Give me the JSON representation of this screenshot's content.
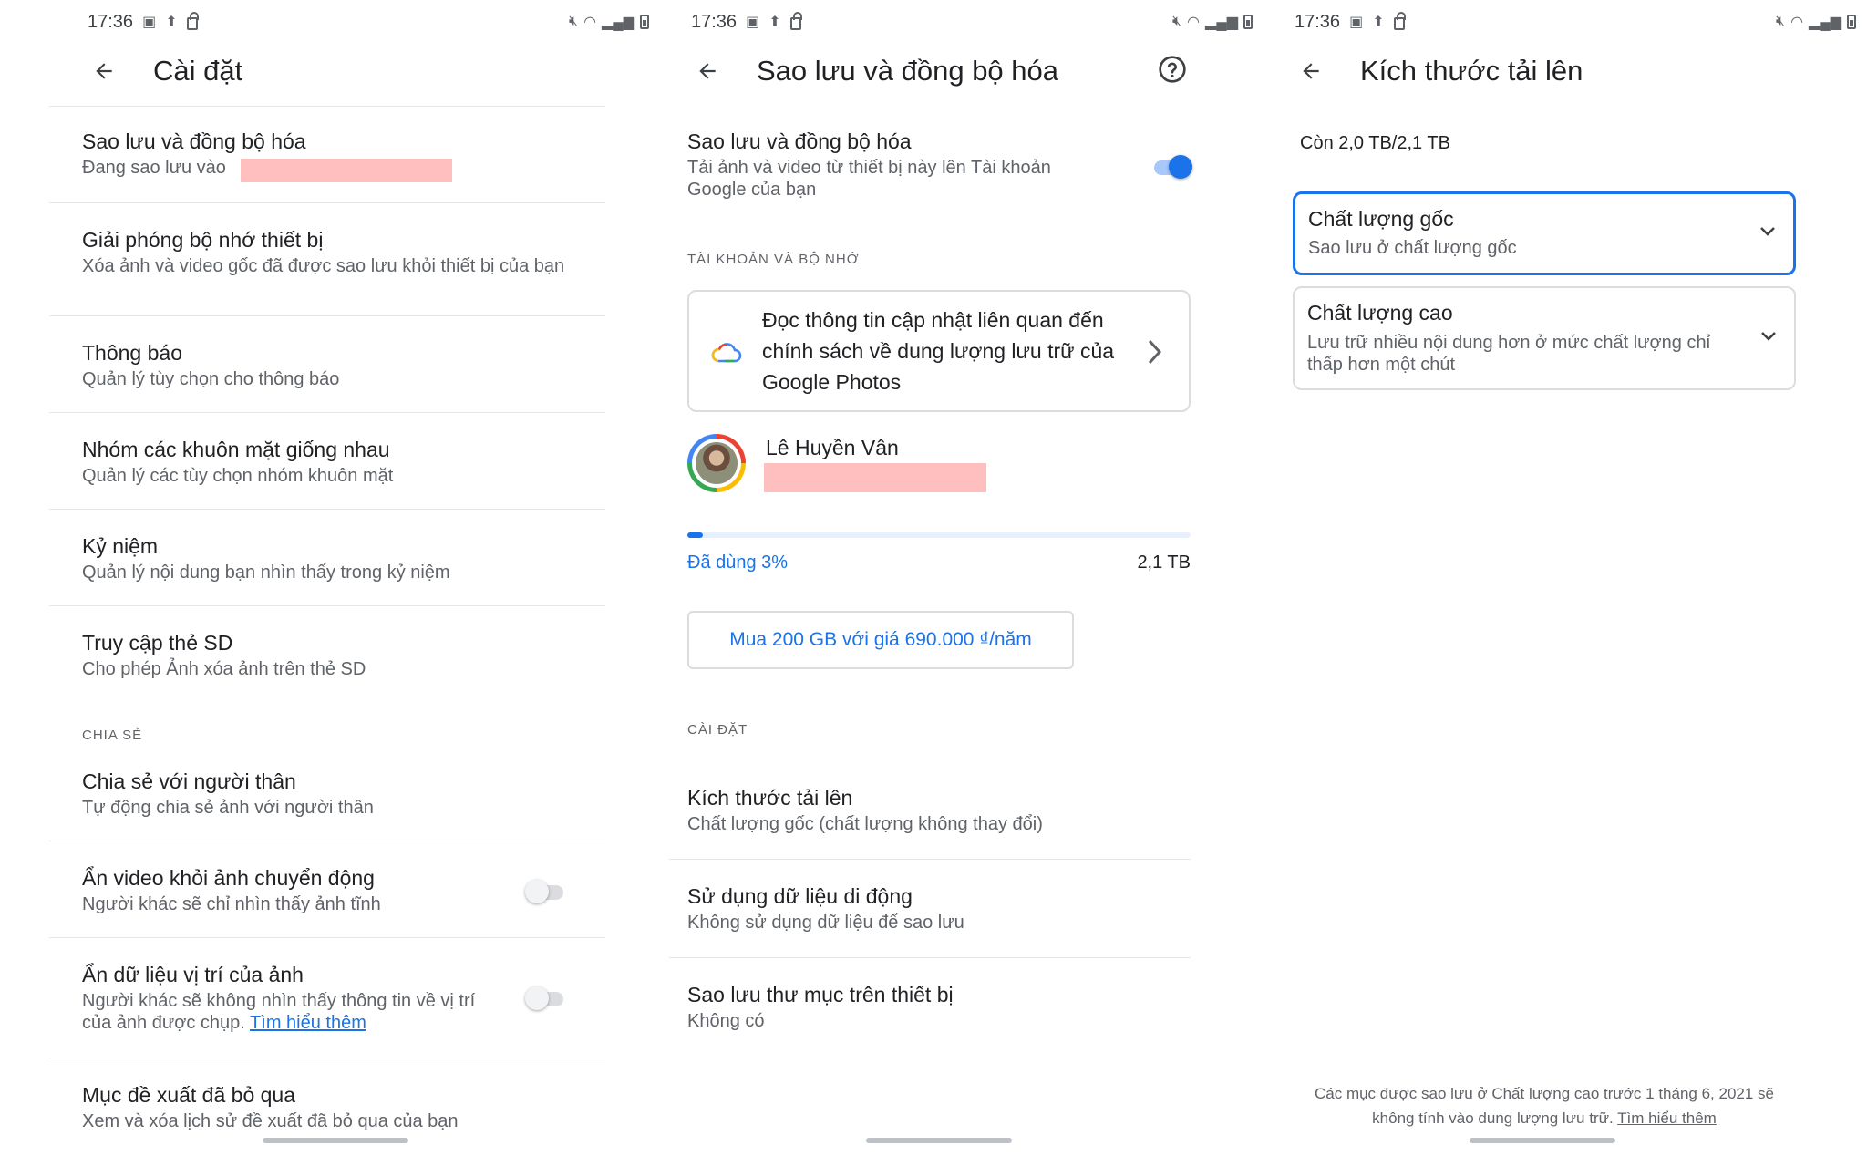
{
  "status": {
    "time": "17:36"
  },
  "panel1": {
    "title": "Cài đặt",
    "items": [
      {
        "title": "Sao lưu và đồng bộ hóa",
        "subtitle": "Đang sao lưu vào"
      },
      {
        "title": "Giải phóng bộ nhớ thiết bị",
        "subtitle": "Xóa ảnh và video gốc đã được sao lưu khỏi thiết bị của bạn"
      },
      {
        "title": "Thông báo",
        "subtitle": "Quản lý tùy chọn cho thông báo"
      },
      {
        "title": "Nhóm các khuôn mặt giống nhau",
        "subtitle": "Quản lý các tùy chọn nhóm khuôn mặt"
      },
      {
        "title": "Kỷ niệm",
        "subtitle": "Quản lý nội dung bạn nhìn thấy trong kỷ niệm"
      },
      {
        "title": "Truy cập thẻ SD",
        "subtitle": "Cho phép Ảnh xóa ảnh trên thẻ SD"
      }
    ],
    "section_sharing": "CHIA SẺ",
    "partner": {
      "title": "Chia sẻ với người thân",
      "subtitle": "Tự động chia sẻ ảnh với người thân"
    },
    "hide_video": {
      "title": "Ẩn video khỏi ảnh chuyển động",
      "subtitle": "Người khác sẽ chỉ nhìn thấy ảnh tĩnh",
      "enabled": false
    },
    "hide_location": {
      "title": "Ẩn dữ liệu vị trí của ảnh",
      "subtitle_line1": "Người khác sẽ không nhìn thấy thông tin về vị trí",
      "subtitle_line2": "của ảnh được chụp.",
      "link": "Tìm hiểu thêm",
      "enabled": false
    },
    "skipped": {
      "title": "Mục đề xuất đã bỏ qua",
      "subtitle": "Xem và xóa lịch sử đề xuất đã bỏ qua của bạn"
    }
  },
  "panel2": {
    "title": "Sao lưu và đồng bộ hóa",
    "backup": {
      "title": "Sao lưu và đồng bộ hóa",
      "subtitle": "Tải ảnh và video từ thiết bị này lên Tài khoản Google của bạn",
      "enabled": true
    },
    "section_account": "TÀI KHOẢN VÀ BỘ NHỚ",
    "policy_card": "Đọc thông tin cập nhật liên quan đến chính sách về dung lượng lưu trữ của Google Photos",
    "account_name": "Lê Huyền Vân",
    "storage": {
      "used_label": "Đã dùng 3%",
      "used_fraction": 0.03,
      "total": "2,1 TB"
    },
    "buy_button": "Mua 200 GB với giá 690.000 ₫/năm",
    "section_settings": "CÀI ĐẶT",
    "upload_size": {
      "title": "Kích thước tải lên",
      "subtitle": "Chất lượng gốc (chất lượng không thay đổi)"
    },
    "mobile_data": {
      "title": "Sử dụng dữ liệu di động",
      "subtitle": "Không sử dụng dữ liệu để sao lưu"
    },
    "device_folders": {
      "title": "Sao lưu thư mục trên thiết bị",
      "subtitle": "Không có"
    }
  },
  "panel3": {
    "title": "Kích thước tải lên",
    "remaining": "Còn 2,0 TB/2,1 TB",
    "options": [
      {
        "title": "Chất lượng gốc",
        "subtitle": "Sao lưu ở chất lượng gốc",
        "selected": true
      },
      {
        "title": "Chất lượng cao",
        "subtitle": "Lưu trữ nhiều nội dung hơn ở mức chất lượng chỉ thấp hơn một chút",
        "selected": false
      }
    ],
    "footnote_line1": "Các mục được sao lưu ở Chất lượng cao trước 1 tháng 6, 2021 sẽ",
    "footnote_line2": "không tính vào dung lượng lưu trữ.",
    "footnote_link": "Tìm hiểu thêm"
  },
  "colors": {
    "accent": "#1a73e8",
    "redaction": "#ffbfbf"
  }
}
